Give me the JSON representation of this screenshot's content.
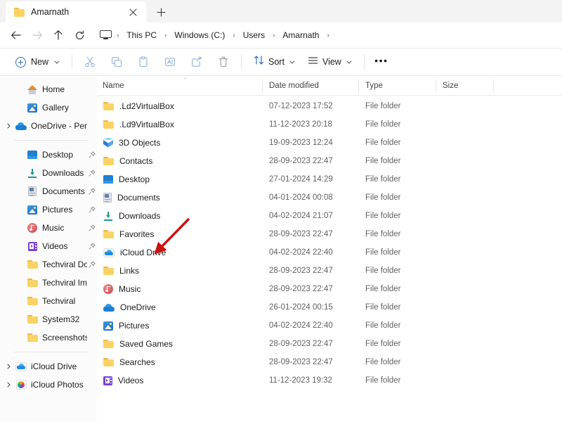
{
  "window": {
    "tab": {
      "title": "Amarnath",
      "folder_icon": "folder-icon",
      "close_icon": "close-icon"
    },
    "new_tab_icon": "plus-icon"
  },
  "nav": {
    "back_icon": "arrow-left-icon",
    "forward_icon": "arrow-right-icon",
    "up_icon": "arrow-up-icon",
    "refresh_icon": "refresh-icon",
    "address": {
      "root_icon": "this-pc-monitor-icon",
      "separator": "›",
      "crumbs": [
        "This PC",
        "Windows (C:)",
        "Users",
        "Amarnath"
      ]
    }
  },
  "toolbar": {
    "new_label": "New",
    "new_icon": "plus-circle-icon",
    "chevron": "⌄",
    "cut_icon": "cut-scissors-icon",
    "copy_icon": "copy-icon",
    "paste_icon": "paste-icon",
    "rename_icon": "rename-icon",
    "share_icon": "share-icon",
    "delete_icon": "delete-trash-icon",
    "sort_label": "Sort",
    "sort_icon": "sort-arrows-icon",
    "view_label": "View",
    "view_icon": "view-lines-icon",
    "more_label": "•••",
    "more_icon": "more-ellipsis-icon"
  },
  "sidebar": {
    "groups": [
      {
        "items": [
          {
            "label": "Home",
            "icon": "home-icon",
            "chevron": false,
            "pinned": false,
            "indent": 1
          },
          {
            "label": "Gallery",
            "icon": "gallery-icon",
            "chevron": false,
            "pinned": false,
            "indent": 1
          },
          {
            "label": "OneDrive - Persona",
            "icon": "onedrive-cloud-icon",
            "chevron": true,
            "pinned": false,
            "indent": 0
          }
        ]
      },
      {
        "items": [
          {
            "label": "Desktop",
            "icon": "desktop-icon",
            "chevron": false,
            "pinned": true,
            "indent": 1
          },
          {
            "label": "Downloads",
            "icon": "downloads-icon",
            "chevron": false,
            "pinned": true,
            "indent": 1
          },
          {
            "label": "Documents",
            "icon": "documents-icon",
            "chevron": false,
            "pinned": true,
            "indent": 1
          },
          {
            "label": "Pictures",
            "icon": "pictures-icon",
            "chevron": false,
            "pinned": true,
            "indent": 1
          },
          {
            "label": "Music",
            "icon": "music-icon",
            "chevron": false,
            "pinned": true,
            "indent": 1
          },
          {
            "label": "Videos",
            "icon": "videos-icon",
            "chevron": false,
            "pinned": true,
            "indent": 1
          },
          {
            "label": "Techviral Docum",
            "icon": "folder-icon",
            "chevron": false,
            "pinned": true,
            "indent": 1
          },
          {
            "label": "Techviral Images",
            "icon": "folder-icon",
            "chevron": false,
            "pinned": false,
            "indent": 1
          },
          {
            "label": "Techviral",
            "icon": "folder-icon",
            "chevron": false,
            "pinned": false,
            "indent": 1
          },
          {
            "label": "System32",
            "icon": "folder-icon",
            "chevron": false,
            "pinned": false,
            "indent": 1
          },
          {
            "label": "Screenshots",
            "icon": "folder-icon",
            "chevron": false,
            "pinned": false,
            "indent": 1
          }
        ]
      },
      {
        "items": [
          {
            "label": "iCloud Drive",
            "icon": "icloud-drive-icon",
            "chevron": true,
            "pinned": false,
            "indent": 0
          },
          {
            "label": "iCloud Photos",
            "icon": "icloud-photos-icon",
            "chevron": true,
            "pinned": false,
            "indent": 0
          }
        ]
      }
    ]
  },
  "filelist": {
    "sort_indicator": "⌃",
    "columns": [
      {
        "key": "name",
        "label": "Name"
      },
      {
        "key": "date",
        "label": "Date modified"
      },
      {
        "key": "type",
        "label": "Type"
      },
      {
        "key": "size",
        "label": "Size"
      }
    ],
    "rows": [
      {
        "name": ".Ld2VirtualBox",
        "date": "07-12-2023 17:52",
        "type": "File folder",
        "size": "",
        "icon": "folder-icon"
      },
      {
        "name": ".Ld9VirtualBox",
        "date": "11-12-2023 20:18",
        "type": "File folder",
        "size": "",
        "icon": "folder-icon"
      },
      {
        "name": "3D Objects",
        "date": "19-09-2023 12:24",
        "type": "File folder",
        "size": "",
        "icon": "3d-objects-icon"
      },
      {
        "name": "Contacts",
        "date": "28-09-2023 22:47",
        "type": "File folder",
        "size": "",
        "icon": "folder-icon"
      },
      {
        "name": "Desktop",
        "date": "27-01-2024 14:29",
        "type": "File folder",
        "size": "",
        "icon": "desktop-icon"
      },
      {
        "name": "Documents",
        "date": "04-01-2024 00:08",
        "type": "File folder",
        "size": "",
        "icon": "documents-icon"
      },
      {
        "name": "Downloads",
        "date": "04-02-2024 21:07",
        "type": "File folder",
        "size": "",
        "icon": "downloads-icon"
      },
      {
        "name": "Favorites",
        "date": "28-09-2023 22:47",
        "type": "File folder",
        "size": "",
        "icon": "folder-icon"
      },
      {
        "name": "iCloud Drive",
        "date": "04-02-2024 22:40",
        "type": "File folder",
        "size": "",
        "icon": "icloud-drive-icon"
      },
      {
        "name": "Links",
        "date": "28-09-2023 22:47",
        "type": "File folder",
        "size": "",
        "icon": "folder-icon"
      },
      {
        "name": "Music",
        "date": "28-09-2023 22:47",
        "type": "File folder",
        "size": "",
        "icon": "music-icon"
      },
      {
        "name": "OneDrive",
        "date": "26-01-2024 00:15",
        "type": "File folder",
        "size": "",
        "icon": "onedrive-cloud-icon"
      },
      {
        "name": "Pictures",
        "date": "04-02-2024 22:40",
        "type": "File folder",
        "size": "",
        "icon": "pictures-icon"
      },
      {
        "name": "Saved Games",
        "date": "28-09-2023 22:47",
        "type": "File folder",
        "size": "",
        "icon": "folder-icon"
      },
      {
        "name": "Searches",
        "date": "28-09-2023 22:47",
        "type": "File folder",
        "size": "",
        "icon": "folder-icon"
      },
      {
        "name": "Videos",
        "date": "11-12-2023 19:32",
        "type": "File folder",
        "size": "",
        "icon": "videos-icon"
      }
    ]
  },
  "annotation": {
    "arrow_color": "#cc1111",
    "target_label": "iCloud Drive"
  },
  "colors": {
    "accent": "#3a6fb0",
    "folder_yellow": "#fbd264",
    "chrome_bg": "#f3f3f3",
    "sidebar_bg": "#fbfbfb",
    "pane_bg": "#ffffff",
    "text": "#1b1b1b",
    "muted_text": "#616161"
  }
}
